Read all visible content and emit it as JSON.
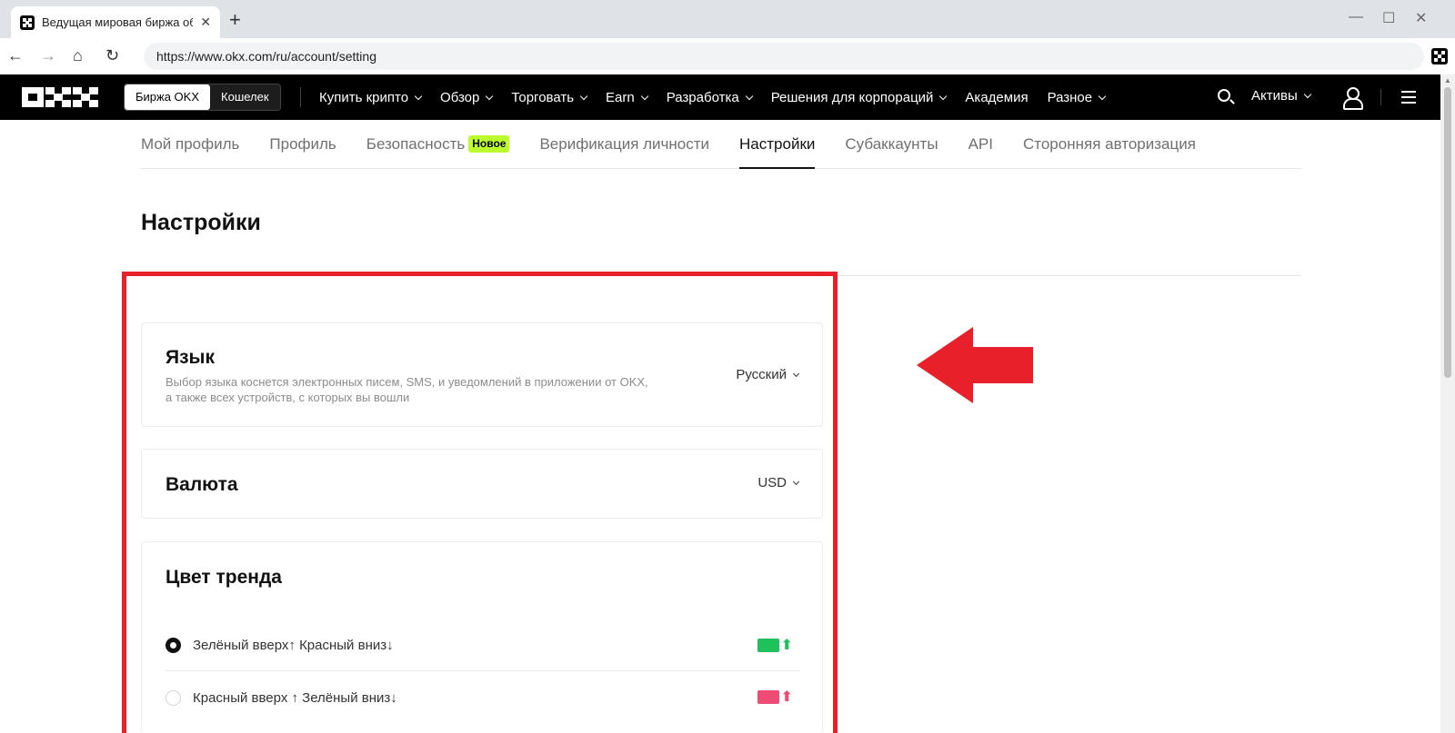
{
  "browser": {
    "tab_title": "Ведущая мировая биржа обм...",
    "url": "https://www.okx.com/ru/account/setting"
  },
  "header": {
    "switch": {
      "exchange": "Биржа OKX",
      "wallet": "Кошелек"
    },
    "nav": [
      "Купить крипто",
      "Обзор",
      "Торговать",
      "Earn",
      "Разработка",
      "Решения для корпораций",
      "Академия",
      "Разное"
    ],
    "assets": "Активы"
  },
  "subnav": {
    "items": [
      "Мой профиль",
      "Профиль",
      "Безопасность",
      "Верификация личности",
      "Настройки",
      "Субаккаунты",
      "API",
      "Сторонняя авторизация"
    ],
    "badge": "Новое",
    "active": "Настройки"
  },
  "page": {
    "title": "Настройки"
  },
  "settings": {
    "language": {
      "title": "Язык",
      "description": "Выбор языка коснется электронных писем, SMS, и уведомлений в приложении от OKX, а также всех устройств, с которых вы вошли",
      "value": "Русский"
    },
    "currency": {
      "title": "Валюта",
      "value": "USD"
    },
    "trend": {
      "title": "Цвет тренда",
      "options": [
        {
          "label": "Зелёный вверх↑ Красный вниз↓",
          "selected": true,
          "color": "#1fc15b"
        },
        {
          "label": "Красный вверх ↑ Зелёный вниз↓",
          "selected": false,
          "color": "#ee4c74"
        }
      ]
    }
  },
  "colors": {
    "highlight": "#e8202a",
    "badge": "#bcff2f",
    "up_green": "#1fc15b",
    "up_red": "#ee4c74"
  }
}
